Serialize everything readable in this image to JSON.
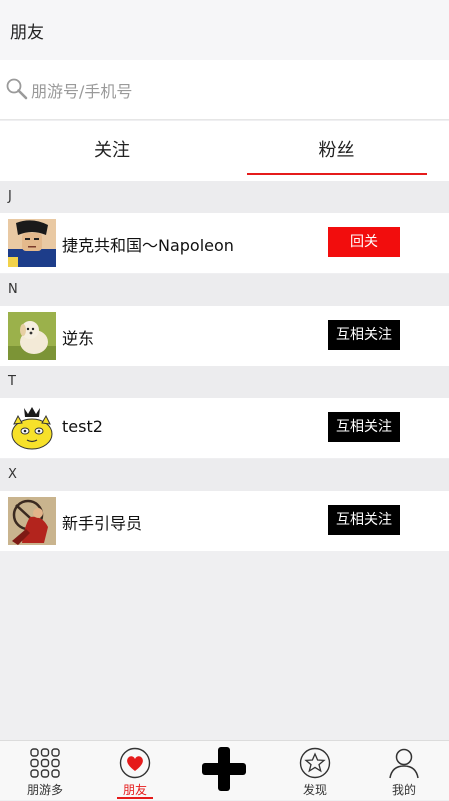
{
  "header": {
    "title": "朋友"
  },
  "search": {
    "placeholder": "朋游号/手机号",
    "icon": "search-icon"
  },
  "tabs": [
    {
      "label": "关注"
    },
    {
      "label": "粉丝",
      "active": true
    }
  ],
  "sections": [
    {
      "letter": "J",
      "name": "捷克共和国～Napoleon",
      "button": "回关",
      "button_color": "#f20d0d",
      "avatar": "anime-man-avatar"
    },
    {
      "letter": "N",
      "name": "逆东",
      "button": "互相关注",
      "button_color": "#000000",
      "avatar": "puppy-avatar"
    },
    {
      "letter": "T",
      "name": "test2",
      "button": "互相关注",
      "button_color": "#000000",
      "avatar": "yellow-cat-crown-avatar"
    },
    {
      "letter": "X",
      "name": "新手引导员",
      "button": "互相关注",
      "button_color": "#000000",
      "avatar": "guide-illustration-avatar"
    }
  ],
  "bottom_nav": [
    {
      "label": "朋游多",
      "icon": "grid-icon"
    },
    {
      "label": "朋友",
      "icon": "heart-icon",
      "active": true
    },
    {
      "label": "",
      "icon": "plus-icon"
    },
    {
      "label": "发现",
      "icon": "star-icon"
    },
    {
      "label": "我的",
      "icon": "user-icon"
    }
  ],
  "colors": {
    "accent": "#e51b1b",
    "follow_back": "#f20d0d",
    "mutual": "#000000"
  }
}
